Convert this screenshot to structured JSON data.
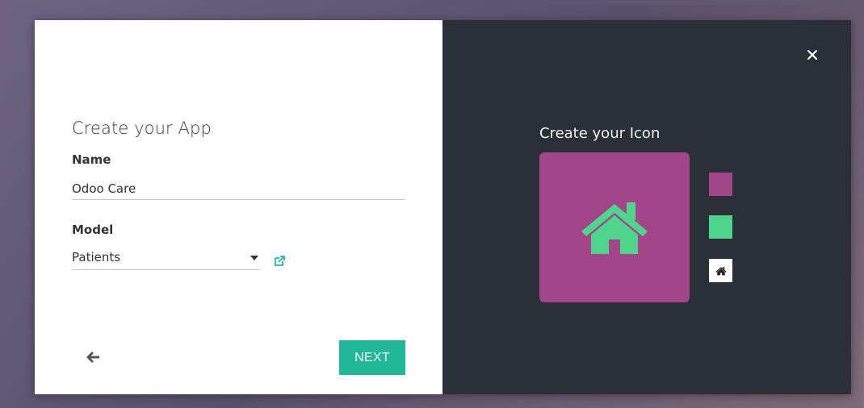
{
  "create_app": {
    "title": "Create your App",
    "name_label": "Name",
    "name_value": "Odoo Care",
    "model_label": "Model",
    "model_value": "Patients",
    "next_label": "NEXT"
  },
  "create_icon": {
    "title": "Create your Icon",
    "icon": "home-icon",
    "background_color": "#a24689",
    "icon_color": "#4ed48b"
  },
  "colors": {
    "accent": "#21b799",
    "panel_dark": "#2b2f38"
  }
}
